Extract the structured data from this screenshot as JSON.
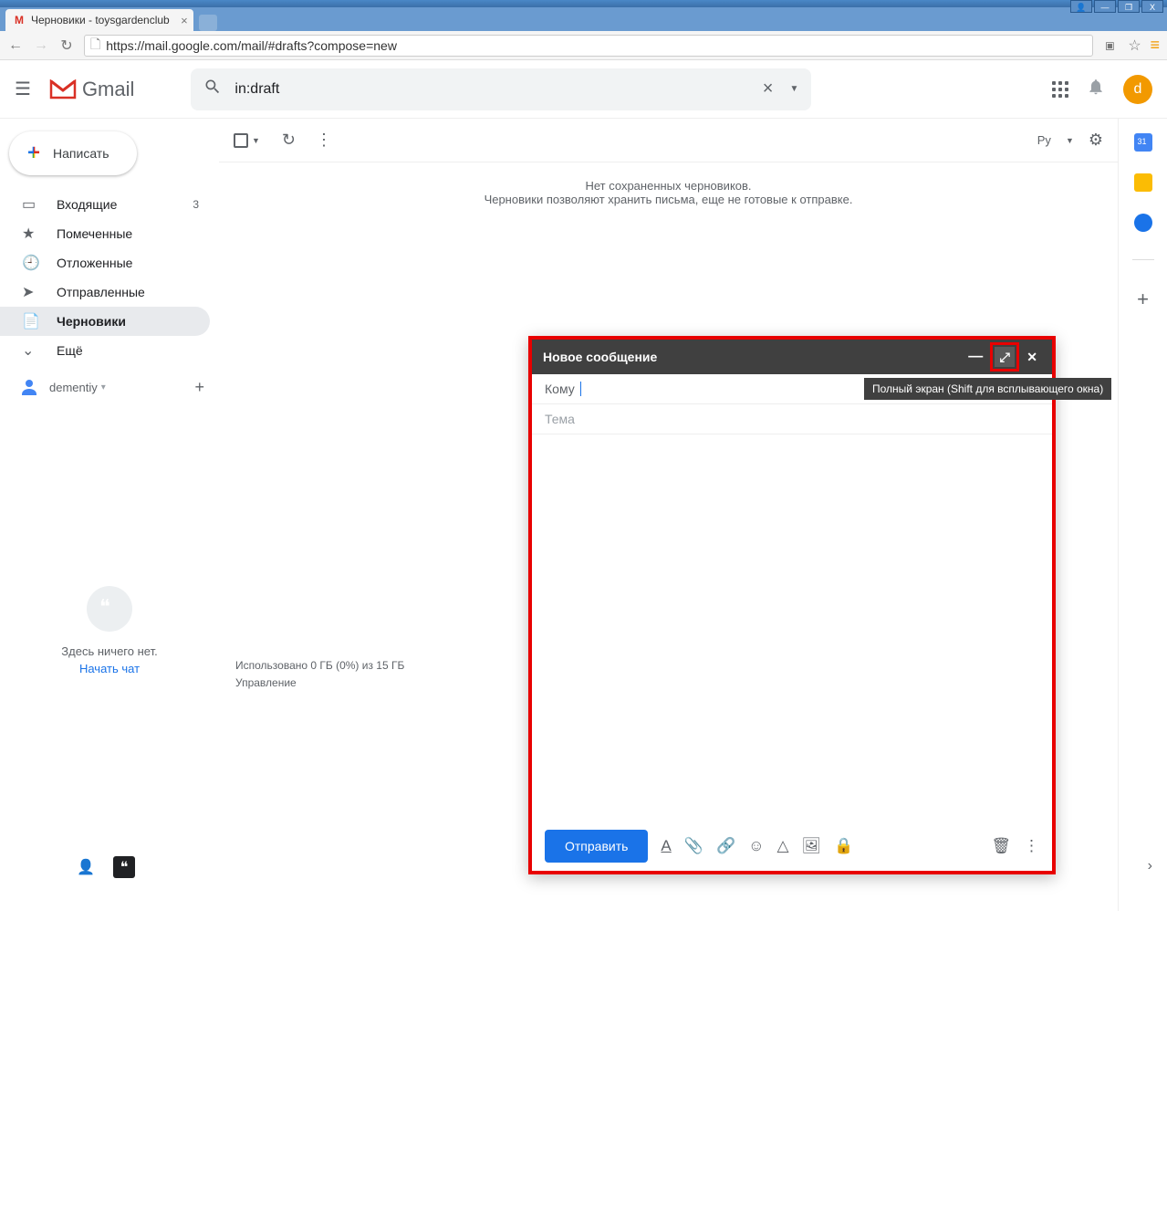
{
  "browser": {
    "tab_title": "Черновики - toysgardenclub",
    "url": "https://mail.google.com/mail/#drafts?compose=new"
  },
  "header": {
    "app_name": "Gmail",
    "search_value": "in:draft",
    "avatar_letter": "d"
  },
  "compose_button": "Написать",
  "sidebar": {
    "items": [
      {
        "icon": "inbox",
        "label": "Входящие",
        "count": "3"
      },
      {
        "icon": "star",
        "label": "Помеченные",
        "count": ""
      },
      {
        "icon": "clock",
        "label": "Отложенные",
        "count": ""
      },
      {
        "icon": "send",
        "label": "Отправленные",
        "count": ""
      },
      {
        "icon": "draft",
        "label": "Черновики",
        "count": ""
      },
      {
        "icon": "more",
        "label": "Ещё",
        "count": ""
      }
    ],
    "user": "dementiy",
    "hangouts_empty1": "Здесь ничего нет.",
    "hangouts_empty2": "Начать чат"
  },
  "toolbar": {
    "lang": "Ру"
  },
  "main": {
    "empty_line1": "Нет сохраненных черновиков.",
    "empty_line2": "Черновики позволяют хранить письма, еще не готовые к отправке.",
    "storage_line1": "Использовано 0 ГБ (0%) из 15 ГБ",
    "storage_line2": "Управление"
  },
  "compose": {
    "title": "Новое сообщение",
    "to_label": "Кому",
    "subject_placeholder": "Тема",
    "send": "Отправить",
    "tooltip": "Полный экран (Shift для всплывающего окна)"
  }
}
